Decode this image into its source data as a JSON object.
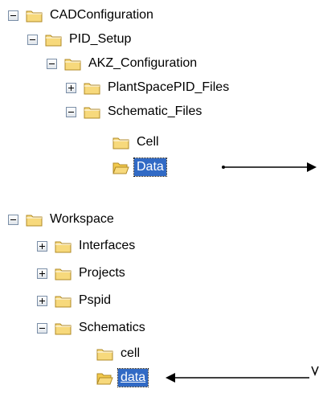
{
  "tree_top": {
    "items": [
      {
        "label": "CADConfiguration",
        "level": 0,
        "toggle": "minus"
      },
      {
        "label": "PID_Setup",
        "level": 1,
        "toggle": "minus"
      },
      {
        "label": "AKZ_Configuration",
        "level": 2,
        "toggle": "minus"
      },
      {
        "label": "PlantSpacePID_Files",
        "level": 3,
        "toggle": "plus"
      },
      {
        "label": "Schematic_Files",
        "level": 3,
        "toggle": "minus"
      },
      {
        "label": "Cell",
        "level": 4,
        "toggle": "none"
      },
      {
        "label": "Data",
        "level": 4,
        "toggle": "none",
        "selected": true,
        "open": true
      }
    ]
  },
  "tree_bottom": {
    "items": [
      {
        "label": "Workspace",
        "level": 0,
        "toggle": "minus"
      },
      {
        "label": "Interfaces",
        "level": 1,
        "toggle": "plus"
      },
      {
        "label": "Projects",
        "level": 1,
        "toggle": "plus"
      },
      {
        "label": "Pspid",
        "level": 1,
        "toggle": "plus"
      },
      {
        "label": "Schematics",
        "level": 1,
        "toggle": "minus"
      },
      {
        "label": "cell",
        "level": 2,
        "toggle": "none"
      },
      {
        "label": "data",
        "level": 2,
        "toggle": "none",
        "selected": true,
        "open": true,
        "underline": true
      }
    ]
  },
  "colors": {
    "selection": "#316ac5",
    "folder_fill": "#f7d97c",
    "folder_stroke": "#b08a26"
  }
}
